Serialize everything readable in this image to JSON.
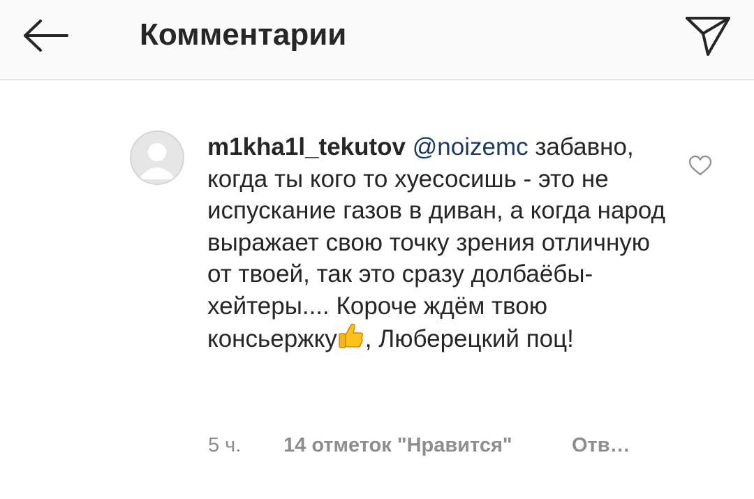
{
  "header": {
    "title": "Комментарии",
    "back_icon": "arrow-left-icon",
    "send_icon": "send-paper-plane-icon"
  },
  "comment": {
    "avatar_icon": "default-avatar-icon",
    "username": "m1kha1l_tekutov",
    "mention": "@noizemc",
    "text_part1": "забавно, когда ты кого то хуесосишь - это не испускание газов в диван, а когда народ выражает свою точку зрения отличную от твоей, так это  сразу долбаёбы-хейтеры.... Короче ждём твою консьержку",
    "emoji_icon": "thumbs-up-emoji",
    "text_part2": ", Люберецкий поц!",
    "like_icon": "heart-outline-icon",
    "time": "5 ч.",
    "likes": "14 отметок \"Нравится\"",
    "reply": "Отв…"
  },
  "colors": {
    "header_bg": "#fafafa",
    "text": "#262626",
    "mention": "#1b3a66",
    "meta": "#8e8e8e",
    "avatar_bg": "#e6e6e6"
  }
}
